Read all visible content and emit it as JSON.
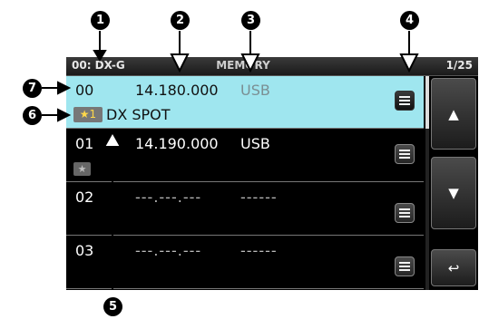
{
  "titlebar": {
    "left": "00: DX-G",
    "center": "MEMORY",
    "right": "1/25"
  },
  "rows": [
    {
      "ch": "00",
      "freq": "14.180.000",
      "mode": "USB",
      "star_label": "★1",
      "name": "DX SPOT"
    },
    {
      "ch": "01",
      "freq": "14.190.000",
      "mode": "USB",
      "star_label": "★"
    },
    {
      "ch": "02",
      "freq": "---.---.---",
      "mode": "------"
    },
    {
      "ch": "03",
      "freq": "---.---.---",
      "mode": "------"
    }
  ],
  "buttons": {
    "up": "▲",
    "down": "▼",
    "back": "↩"
  },
  "callouts": [
    "1",
    "2",
    "3",
    "4",
    "5",
    "6",
    "7"
  ],
  "colors": {
    "selected_row": "#9fe6ef",
    "screen_bg": "#000000",
    "star": "#ffd84a"
  }
}
